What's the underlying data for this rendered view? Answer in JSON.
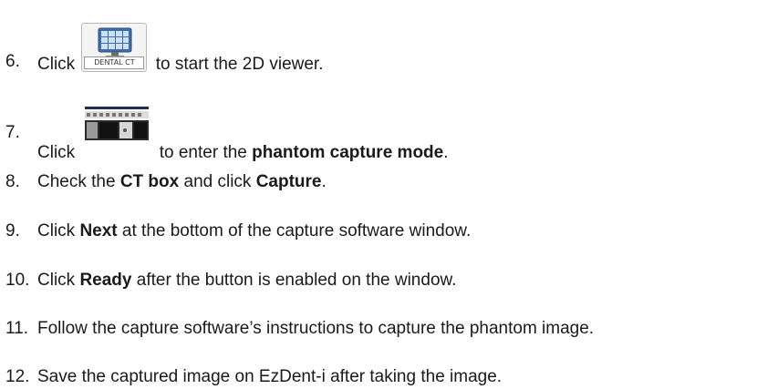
{
  "steps": [
    {
      "num": "6.",
      "pre": "Click",
      "icon": "dental-ct-viewer-icon",
      "icon_caption": "DENTAL CT",
      "post": "to start the 2D viewer."
    },
    {
      "num": "7.",
      "pre": "Click",
      "icon": "phantom-capture-icon",
      "post": "to enter the ",
      "bold": "phantom capture mode",
      "post2": "."
    },
    {
      "num": "8.",
      "pre": "Check the ",
      "bold1": "CT box",
      "mid": " and click ",
      "bold2": "Capture",
      "post": "."
    },
    {
      "num": "9.",
      "pre": "Click ",
      "bold": "Next",
      "post": " at the bottom of the capture software window."
    },
    {
      "num": "10.",
      "pre": "Click ",
      "bold": "Ready",
      "post": " after the button is enabled on the window."
    },
    {
      "num": "11.",
      "text": "Follow the capture software’s instructions to capture the phantom image."
    },
    {
      "num": "12.",
      "text": "Save the captured image on EzDent-i after taking the image."
    }
  ]
}
